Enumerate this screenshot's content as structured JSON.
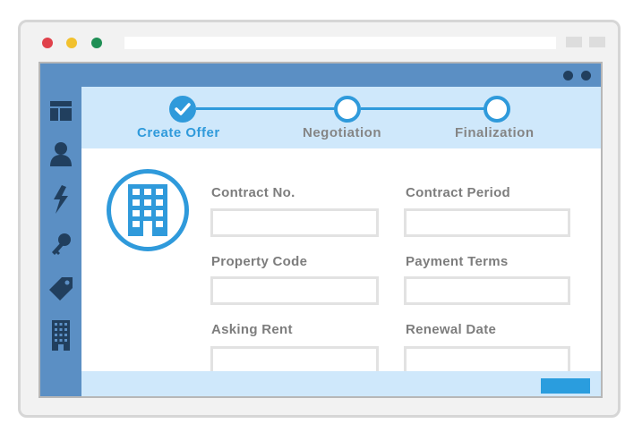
{
  "browser": {
    "address": "",
    "colors": {
      "close": "#e0414b",
      "minimize": "#f2c12e",
      "maximize": "#1f8f55"
    }
  },
  "sidebar": {
    "items": [
      {
        "icon": "layout-icon"
      },
      {
        "icon": "user-icon"
      },
      {
        "icon": "lightning-icon"
      },
      {
        "icon": "key-icon"
      },
      {
        "icon": "tag-icon"
      },
      {
        "icon": "building-icon"
      }
    ]
  },
  "progress": {
    "steps": [
      {
        "label": "Create Offer",
        "state": "completed"
      },
      {
        "label": "Negotiation",
        "state": "pending"
      },
      {
        "label": "Finalization",
        "state": "pending"
      }
    ],
    "accent": "#2f9adb"
  },
  "form": {
    "fields": [
      {
        "label": "Contract No.",
        "value": ""
      },
      {
        "label": "Contract Period",
        "value": ""
      },
      {
        "label": "Property Code",
        "value": ""
      },
      {
        "label": "Payment Terms",
        "value": ""
      },
      {
        "label": "Asking Rent",
        "value": ""
      },
      {
        "label": "Renewal Date",
        "value": ""
      }
    ]
  },
  "footer": {
    "submit_label": ""
  }
}
